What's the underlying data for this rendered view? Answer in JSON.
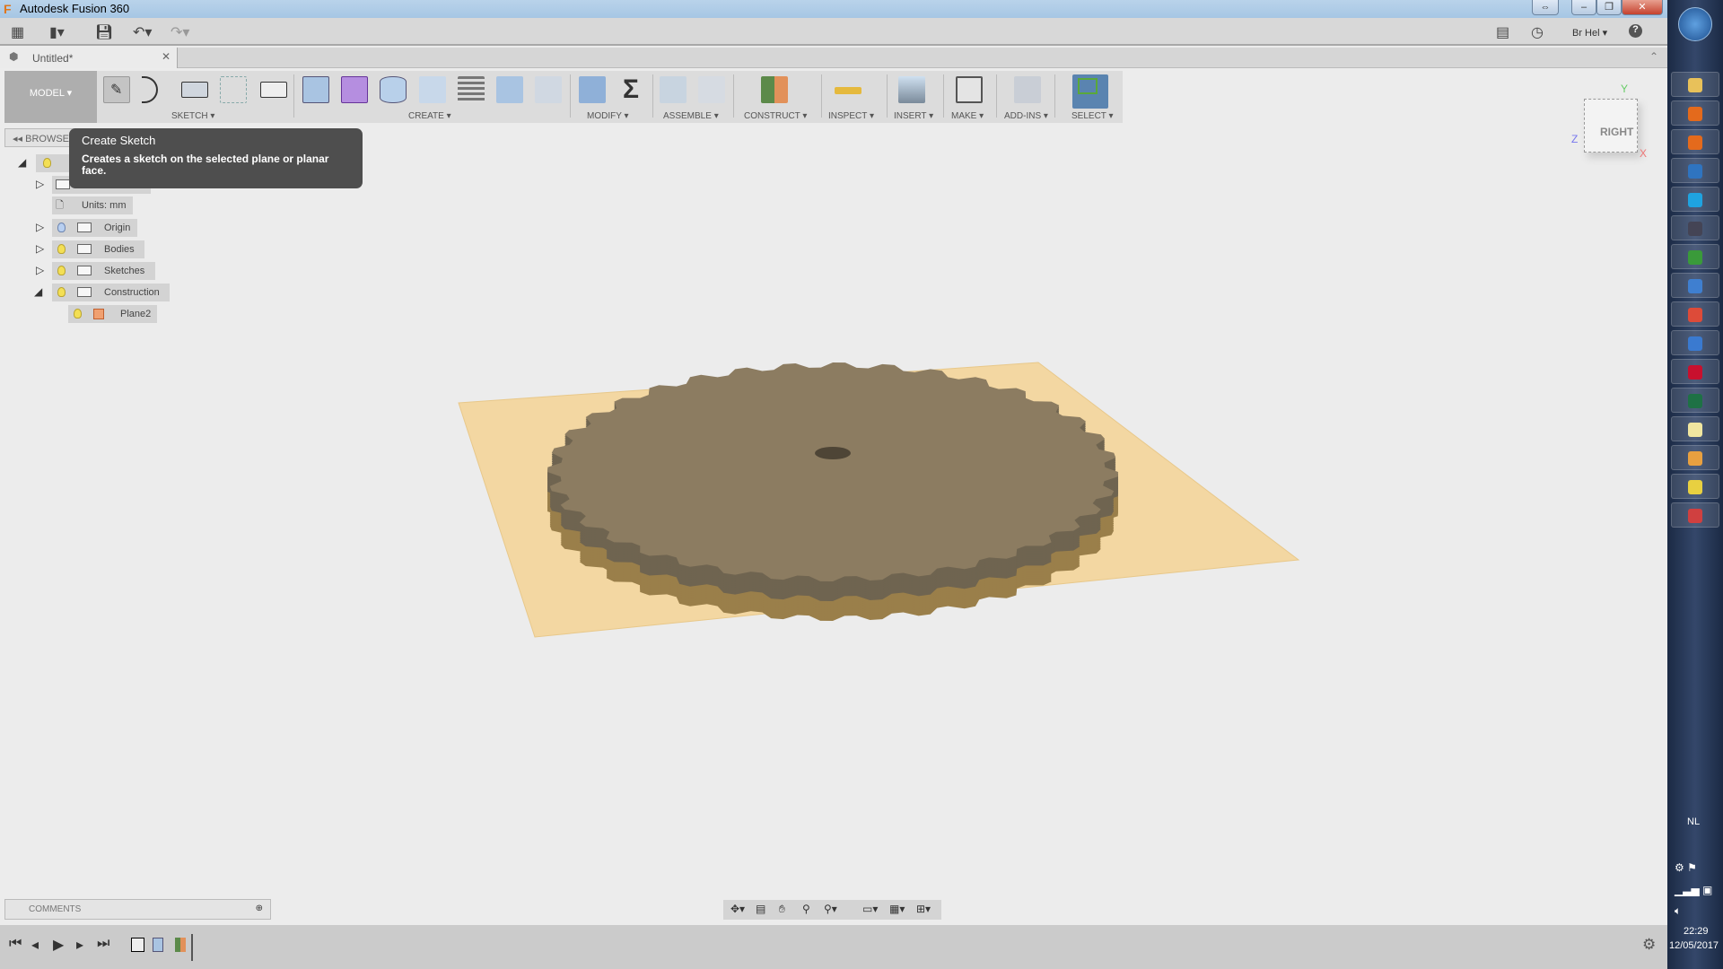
{
  "window": {
    "title": "Autodesk Fusion 360",
    "title_suffix": "..."
  },
  "menubar": {
    "user": "Br Hel",
    "help": "?"
  },
  "tab": {
    "label": "Untitled*"
  },
  "toolbar": {
    "workspace": "MODEL ▾",
    "groups": [
      "SKETCH ▾",
      "CREATE ▾",
      "MODIFY ▾",
      "ASSEMBLE ▾",
      "CONSTRUCT ▾",
      "INSPECT ▾",
      "INSERT ▾",
      "MAKE ▾",
      "ADD-INS ▾",
      "SELECT ▾"
    ]
  },
  "tooltip": {
    "title": "Create Sketch",
    "description": "Creates a sketch on the selected plane or planar face."
  },
  "browser": {
    "header": "BROWSER",
    "items": [
      {
        "label": "Units: mm"
      },
      {
        "label": "Origin"
      },
      {
        "label": "Bodies"
      },
      {
        "label": "Sketches"
      },
      {
        "label": "Construction"
      },
      {
        "label": "Plane2"
      }
    ]
  },
  "viewcube": {
    "face": "RIGHT",
    "x": "X",
    "y": "Y",
    "z": "Z"
  },
  "comments": {
    "label": "COMMENTS"
  },
  "colors": {
    "plane": "#f3d7a2",
    "gear_top": "#8c7c61",
    "gear_side": "#9a7f4a",
    "accent": "#5a84b0"
  },
  "taskbar": {
    "lang": "NL",
    "time": "22:29",
    "date": "12/05/2017"
  }
}
